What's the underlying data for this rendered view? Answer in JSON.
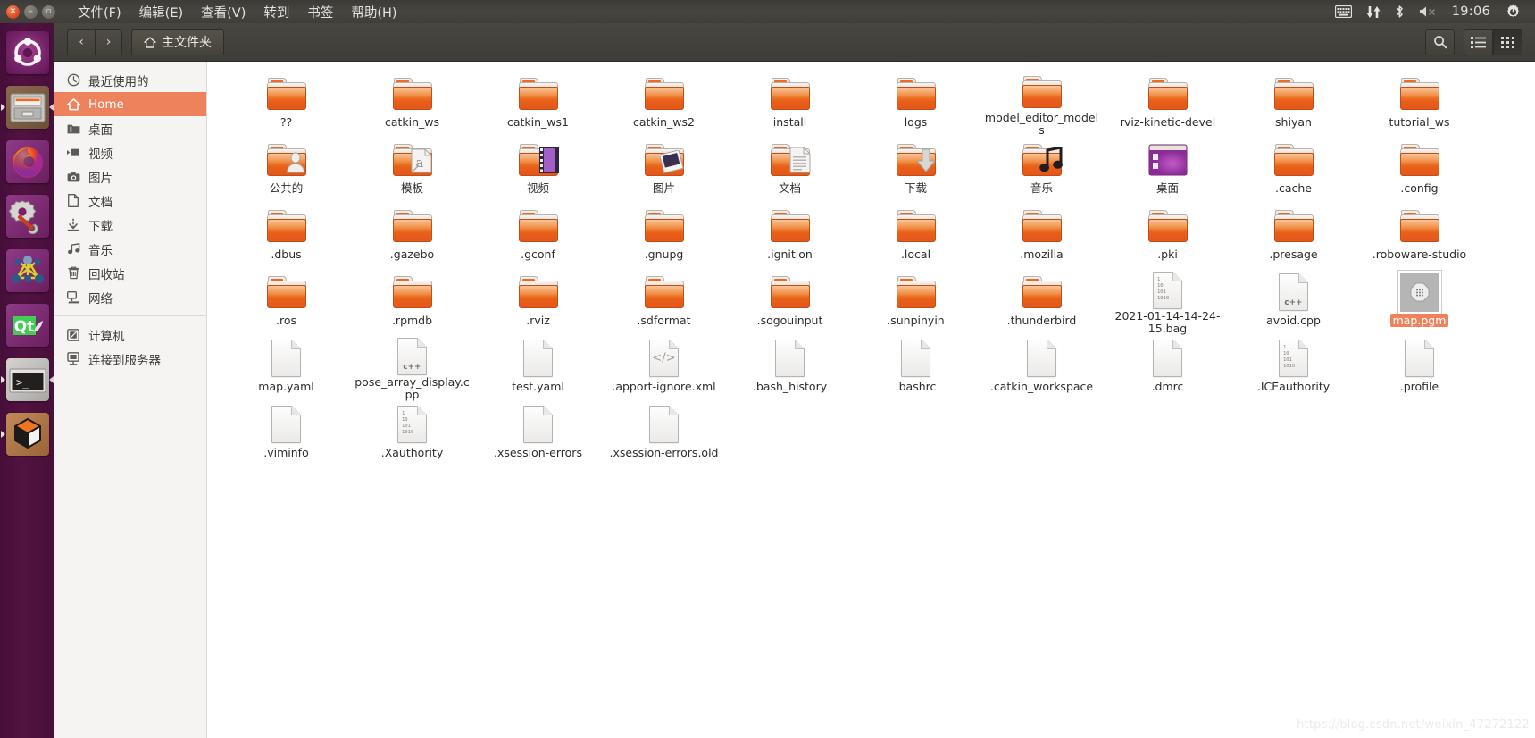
{
  "panel": {
    "window_controls": [
      {
        "name": "close",
        "glyph": "✕"
      },
      {
        "name": "minimize",
        "glyph": "–"
      },
      {
        "name": "maximize",
        "glyph": "▫"
      }
    ],
    "menus": [
      "文件(F)",
      "编辑(E)",
      "查看(V)",
      "转到",
      "书签",
      "帮助(H)"
    ],
    "tray": [
      "keyboard-icon",
      "network-icon",
      "bluetooth-icon",
      "volume-muted-icon"
    ],
    "clock": "19:06",
    "session_icon": "power-gear-icon"
  },
  "launcher": {
    "items": [
      {
        "name": "ubuntu-dash",
        "label": "Ubuntu Dash",
        "running": false
      },
      {
        "name": "files",
        "label": "Files",
        "running": true
      },
      {
        "name": "firefox",
        "label": "Firefox",
        "running": false
      },
      {
        "name": "system-settings",
        "label": "System Settings",
        "running": false
      },
      {
        "name": "ros-rviz",
        "label": "RViz",
        "running": false
      },
      {
        "name": "qt-creator",
        "label": "Qt Creator",
        "running": false
      },
      {
        "name": "terminal",
        "label": "Terminal",
        "running": true
      },
      {
        "name": "gazebo",
        "label": "Gazebo",
        "running": true
      }
    ]
  },
  "toolbar": {
    "back_glyph": "‹",
    "forward_glyph": "›",
    "breadcrumb_label": "主文件夹",
    "breadcrumb_icon": "home-icon",
    "search_icon": "search-icon",
    "list_view_icon": "list-view-icon",
    "grid_view_icon": "grid-view-icon",
    "active_view": "grid"
  },
  "sidebar": {
    "items": [
      {
        "label": "最近使用的",
        "icon": "clock-icon",
        "selected": false
      },
      {
        "label": "Home",
        "icon": "home-icon",
        "selected": true
      },
      {
        "label": "桌面",
        "icon": "desktop-folder-icon",
        "selected": false
      },
      {
        "label": "视频",
        "icon": "video-icon",
        "selected": false
      },
      {
        "label": "图片",
        "icon": "camera-icon",
        "selected": false
      },
      {
        "label": "文档",
        "icon": "document-icon",
        "selected": false
      },
      {
        "label": "下载",
        "icon": "download-icon",
        "selected": false
      },
      {
        "label": "音乐",
        "icon": "music-icon",
        "selected": false
      },
      {
        "label": "回收站",
        "icon": "trash-icon",
        "selected": false
      },
      {
        "label": "网络",
        "icon": "network-icon",
        "selected": false
      }
    ],
    "devices": [
      {
        "label": "计算机",
        "icon": "computer-icon"
      },
      {
        "label": "连接到服务器",
        "icon": "server-connect-icon"
      }
    ]
  },
  "files": {
    "items": [
      {
        "name": "??",
        "type": "folder",
        "emblem": "none",
        "selected": false
      },
      {
        "name": "catkin_ws",
        "type": "folder",
        "emblem": "none",
        "selected": false
      },
      {
        "name": "catkin_ws1",
        "type": "folder",
        "emblem": "none",
        "selected": false
      },
      {
        "name": "catkin_ws2",
        "type": "folder",
        "emblem": "none",
        "selected": false
      },
      {
        "name": "install",
        "type": "folder",
        "emblem": "none",
        "selected": false
      },
      {
        "name": "logs",
        "type": "folder",
        "emblem": "none",
        "selected": false
      },
      {
        "name": "model_editor_models",
        "type": "folder",
        "emblem": "none",
        "selected": false
      },
      {
        "name": "rviz-kinetic-devel",
        "type": "folder",
        "emblem": "none",
        "selected": false
      },
      {
        "name": "shiyan",
        "type": "folder",
        "emblem": "none",
        "selected": false
      },
      {
        "name": "tutorial_ws",
        "type": "folder",
        "emblem": "none",
        "selected": false
      },
      {
        "name": "公共的",
        "type": "folder",
        "emblem": "person",
        "selected": false
      },
      {
        "name": "模板",
        "type": "folder",
        "emblem": "template",
        "selected": false
      },
      {
        "name": "视频",
        "type": "folder",
        "emblem": "film",
        "selected": false
      },
      {
        "name": "图片",
        "type": "folder",
        "emblem": "photo",
        "selected": false
      },
      {
        "name": "文档",
        "type": "folder",
        "emblem": "paper",
        "selected": false
      },
      {
        "name": "下载",
        "type": "folder",
        "emblem": "arrow-down",
        "selected": false
      },
      {
        "name": "音乐",
        "type": "folder",
        "emblem": "note",
        "selected": false
      },
      {
        "name": "桌面",
        "type": "desktop",
        "emblem": "none",
        "selected": false
      },
      {
        "name": ".cache",
        "type": "folder",
        "emblem": "none",
        "selected": false
      },
      {
        "name": ".config",
        "type": "folder",
        "emblem": "none",
        "selected": false
      },
      {
        "name": ".dbus",
        "type": "folder",
        "emblem": "none",
        "selected": false
      },
      {
        "name": ".gazebo",
        "type": "folder",
        "emblem": "none",
        "selected": false
      },
      {
        "name": ".gconf",
        "type": "folder",
        "emblem": "none",
        "selected": false
      },
      {
        "name": ".gnupg",
        "type": "folder",
        "emblem": "none",
        "selected": false
      },
      {
        "name": ".ignition",
        "type": "folder",
        "emblem": "none",
        "selected": false
      },
      {
        "name": ".local",
        "type": "folder",
        "emblem": "none",
        "selected": false
      },
      {
        "name": ".mozilla",
        "type": "folder",
        "emblem": "none",
        "selected": false
      },
      {
        "name": ".pki",
        "type": "folder",
        "emblem": "none",
        "selected": false
      },
      {
        "name": ".presage",
        "type": "folder",
        "emblem": "none",
        "selected": false
      },
      {
        "name": ".roboware-studio",
        "type": "folder",
        "emblem": "none",
        "selected": false
      },
      {
        "name": ".ros",
        "type": "folder",
        "emblem": "none",
        "selected": false
      },
      {
        "name": ".rpmdb",
        "type": "folder",
        "emblem": "none",
        "selected": false
      },
      {
        "name": ".rviz",
        "type": "folder",
        "emblem": "none",
        "selected": false
      },
      {
        "name": ".sdformat",
        "type": "folder",
        "emblem": "none",
        "selected": false
      },
      {
        "name": ".sogouinput",
        "type": "folder",
        "emblem": "none",
        "selected": false
      },
      {
        "name": ".sunpinyin",
        "type": "folder",
        "emblem": "none",
        "selected": false
      },
      {
        "name": ".thunderbird",
        "type": "folder",
        "emblem": "none",
        "selected": false
      },
      {
        "name": "2021-01-14-14-24-15.bag",
        "type": "binary",
        "emblem": "none",
        "selected": false
      },
      {
        "name": "avoid.cpp",
        "type": "cpp",
        "emblem": "none",
        "selected": false
      },
      {
        "name": "map.pgm",
        "type": "image",
        "emblem": "none",
        "selected": true
      },
      {
        "name": "map.yaml",
        "type": "text",
        "emblem": "none",
        "selected": false
      },
      {
        "name": "pose_array_display.cpp",
        "type": "cpp",
        "emblem": "none",
        "selected": false
      },
      {
        "name": "test.yaml",
        "type": "text",
        "emblem": "none",
        "selected": false
      },
      {
        "name": ".apport-ignore.xml",
        "type": "xml",
        "emblem": "none",
        "selected": false
      },
      {
        "name": ".bash_history",
        "type": "text",
        "emblem": "none",
        "selected": false
      },
      {
        "name": ".bashrc",
        "type": "text",
        "emblem": "none",
        "selected": false
      },
      {
        "name": ".catkin_workspace",
        "type": "text",
        "emblem": "none",
        "selected": false
      },
      {
        "name": ".dmrc",
        "type": "text",
        "emblem": "none",
        "selected": false
      },
      {
        "name": ".ICEauthority",
        "type": "binary",
        "emblem": "none",
        "selected": false
      },
      {
        "name": ".profile",
        "type": "text",
        "emblem": "none",
        "selected": false
      },
      {
        "name": ".viminfo",
        "type": "text",
        "emblem": "none",
        "selected": false
      },
      {
        "name": ".Xauthority",
        "type": "binary",
        "emblem": "none",
        "selected": false
      },
      {
        "name": ".xsession-errors",
        "type": "text",
        "emblem": "none",
        "selected": false
      },
      {
        "name": ".xsession-errors.old",
        "type": "text",
        "emblem": "none",
        "selected": false
      }
    ]
  },
  "watermark": "https://blog.csdn.net/weixin_47272122",
  "colors": {
    "accent": "#ed825c",
    "panel": "#403e39",
    "launcher": "#4c1039",
    "folder": "#e8601a"
  }
}
